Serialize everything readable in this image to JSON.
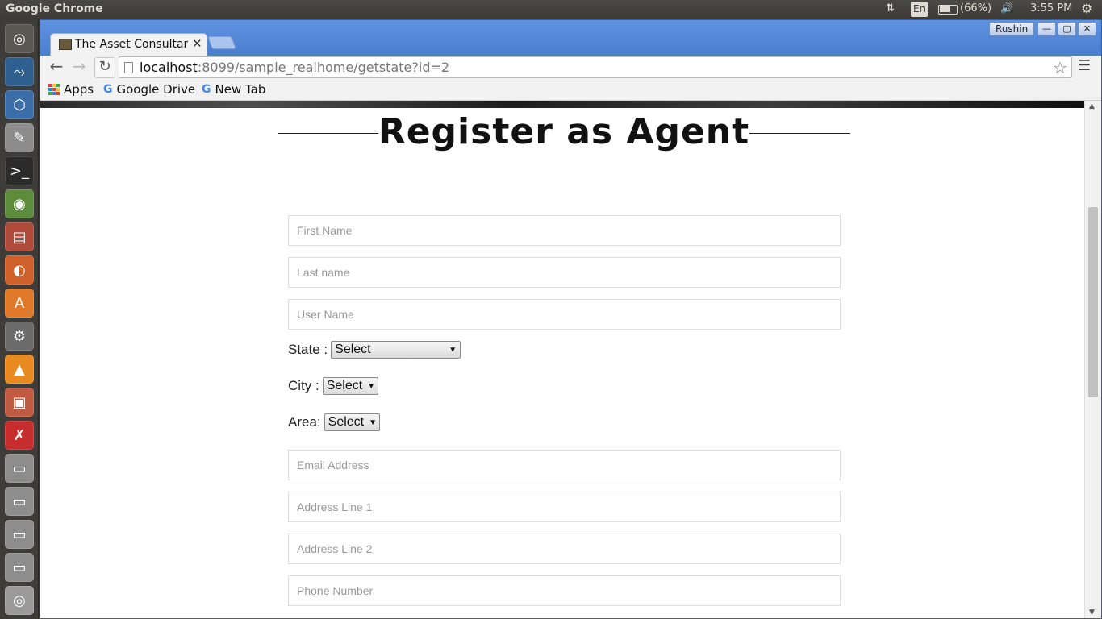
{
  "top_panel": {
    "app_title": "Google Chrome",
    "lang": "En",
    "battery": "(66%)",
    "clock": "3:55 PM"
  },
  "launcher": {
    "items": [
      "dash-icon",
      "mysql-workbench-icon",
      "virtualbox-icon",
      "text-editor-icon",
      "terminal-icon",
      "chrome-icon",
      "files-icon",
      "firefox-icon",
      "software-center-icon",
      "system-settings-icon",
      "vlc-icon",
      "archive-icon",
      "draw-icon",
      "drive-icon",
      "drive-icon",
      "drive-icon",
      "drive-icon",
      "dvd-icon"
    ]
  },
  "browser": {
    "tab_title": "The Asset Consultan",
    "user_button": "Rushin",
    "url_host": "localhost",
    "url_rest": ":8099/sample_realhome/getstate?id=2",
    "bookmarks": [
      "Apps",
      "Google Drive",
      "New Tab"
    ]
  },
  "page": {
    "heading": "Register as Agent",
    "fields": {
      "first_name": "First Name",
      "last_name": "Last name",
      "user_name": "User Name",
      "email": "Email Address",
      "address1": "Address Line 1",
      "address2": "Address Line 2",
      "phone": "Phone Number"
    },
    "state_label": "State :",
    "city_label": "City :",
    "area_label": "Area:",
    "state_value": "Select",
    "city_value": "Select",
    "area_value": "Select"
  },
  "colors": {
    "window_frame": "#4f82d3",
    "panel": "#3c3b37",
    "launcher": "#3e3c39"
  }
}
